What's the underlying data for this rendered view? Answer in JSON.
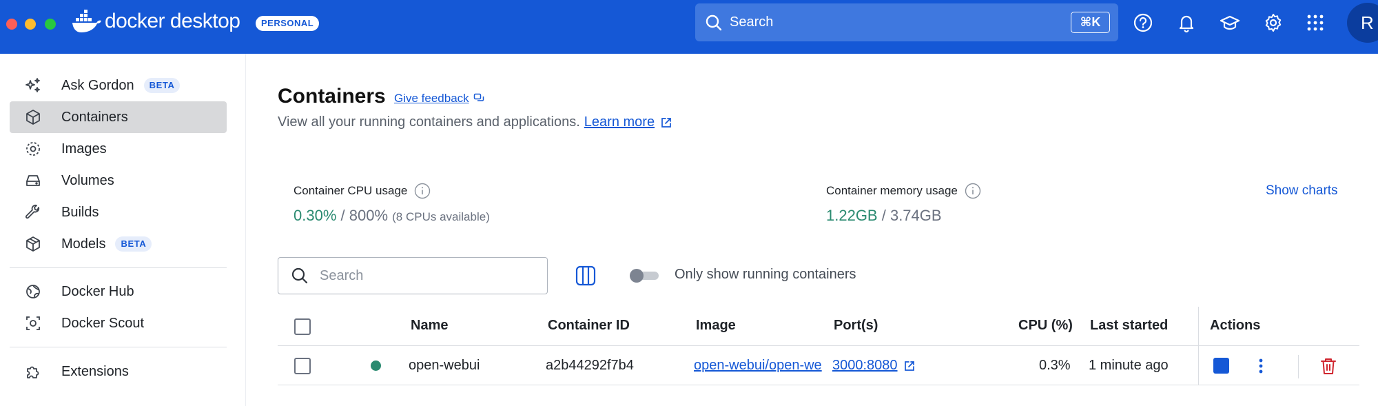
{
  "header": {
    "app_name": "docker desktop",
    "plan_badge": "PERSONAL",
    "search_placeholder": "Search",
    "search_shortcut": "⌘K",
    "avatar_initial": "R",
    "colors": {
      "bar": "#1558d6"
    }
  },
  "sidebar": {
    "items": [
      {
        "label": "Ask Gordon",
        "badge": "BETA",
        "icon": "sparkle-icon"
      },
      {
        "label": "Containers",
        "icon": "container-icon",
        "active": true
      },
      {
        "label": "Images",
        "icon": "images-icon"
      },
      {
        "label": "Volumes",
        "icon": "volume-icon"
      },
      {
        "label": "Builds",
        "icon": "wrench-icon"
      },
      {
        "label": "Models",
        "badge": "BETA",
        "icon": "cube-icon"
      },
      {
        "label": "Docker Hub",
        "icon": "hub-icon"
      },
      {
        "label": "Docker Scout",
        "icon": "scout-icon"
      },
      {
        "label": "Extensions",
        "icon": "puzzle-icon"
      }
    ]
  },
  "main": {
    "title": "Containers",
    "feedback_link": "Give feedback",
    "subtitle": "View all your running containers and applications.",
    "learn_more": "Learn more",
    "cpu": {
      "label": "Container CPU usage",
      "used": "0.30%",
      "sep": " / ",
      "total": "800%",
      "note": "(8 CPUs available)"
    },
    "memory": {
      "label": "Container memory usage",
      "used": "1.22GB",
      "sep": " / ",
      "total": "3.74GB"
    },
    "show_charts": "Show charts",
    "filter": {
      "placeholder": "Search",
      "toggle_label": "Only show running containers",
      "toggle_on": false
    },
    "table": {
      "headers": {
        "name": "Name",
        "id": "Container ID",
        "image": "Image",
        "ports": "Port(s)",
        "cpu": "CPU (%)",
        "last_started": "Last started",
        "actions": "Actions"
      },
      "rows": [
        {
          "name": "open-webui",
          "status": "running",
          "id": "a2b44292f7b4",
          "image": "open-webui/open-we",
          "ports": "3000:8080",
          "cpu": "0.3%",
          "last_started": "1 minute ago"
        }
      ]
    }
  }
}
